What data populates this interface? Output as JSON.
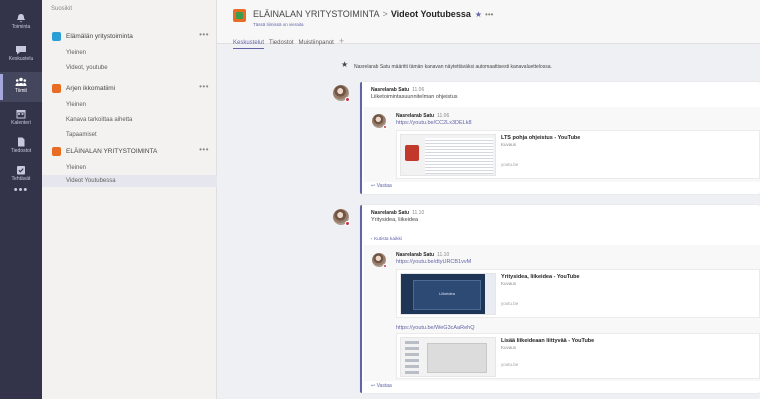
{
  "rail": [
    {
      "label": "Toiminta",
      "icon": "bell-icon"
    },
    {
      "label": "Keskustelu",
      "icon": "chat-icon"
    },
    {
      "label": "Tiimit",
      "icon": "teams-icon"
    },
    {
      "label": "Kalenteri",
      "icon": "calendar-icon"
    },
    {
      "label": "Tiedostot",
      "icon": "files-icon"
    },
    {
      "label": "Tehtävät",
      "icon": "tasks-icon"
    }
  ],
  "sidebar": {
    "header": "Suosikit",
    "teams": [
      {
        "name": "Elämälän yritystoiminta",
        "color": "#2a9fd6",
        "channels": [
          "Yleinen",
          "Videot, youtube"
        ]
      },
      {
        "name": "Arjen ikkomatiimi",
        "color": "#e96c23",
        "channels": [
          "Yleinen",
          "Kanava tarkoittaa aihetta",
          "Tapaamiset"
        ]
      },
      {
        "name": "ELÄINALAN YRITYSTOIMINTA",
        "color": "#e96c23",
        "channels": [
          "Yleinen",
          "Videot Youtubessa"
        ]
      }
    ]
  },
  "header": {
    "team": "ELÄINALAN YRITYSTOIMINTA",
    "separator": ">",
    "channel": "Videot Youtubessa",
    "subtitle": "Tässä tiimissä on vieraita",
    "tabs": [
      "Keskustelut",
      "Tiedostot",
      "Muistiinpanot"
    ]
  },
  "system_message": "Nasrelarab Satu määritti tämän kanavan näytettäväksi automaattisesti kanavaluettelossa.",
  "posts": [
    {
      "author": "Nasrelarab Satu",
      "time": "11.06",
      "text": "Liiketoimintasuunnitelman ohjeistus",
      "reply_author": "Nasrelarab Satu",
      "reply_time": "11.06",
      "reply_link": "https://youtu.be/CC2Lx3DELk8",
      "preview_title": "LTS pohja ohjeistus - YouTube",
      "preview_desc": "Kuvaus",
      "preview_domain": "youtu.be",
      "reply_action": "Vastaa"
    },
    {
      "author": "Nasrelarab Satu",
      "time": "11.10",
      "text": "Yritysidea, liikeidea",
      "collapse": "Kutista kaikki",
      "reply_author": "Nasrelarab Satu",
      "reply_time": "11.10",
      "reply_link": "https://youtu.be/dtyURCB1vvM",
      "preview_title": "Yritysidea, liikeidea - YouTube",
      "preview_desc": "Kuvaus",
      "preview_domain": "youtu.be",
      "thumb_caption": "Liikeidea",
      "reply_link2": "https://youtu.be/WeG3cAaRehQ",
      "preview2_title": "Lisää liikeideaan liittyvää - YouTube",
      "preview2_desc": "Kuvaus",
      "preview2_domain": "youtu.be",
      "reply_action": "Vastaa"
    }
  ],
  "colors": {
    "accent": "#6264a7",
    "rail": "#33344a",
    "presence": "#c4314b"
  }
}
